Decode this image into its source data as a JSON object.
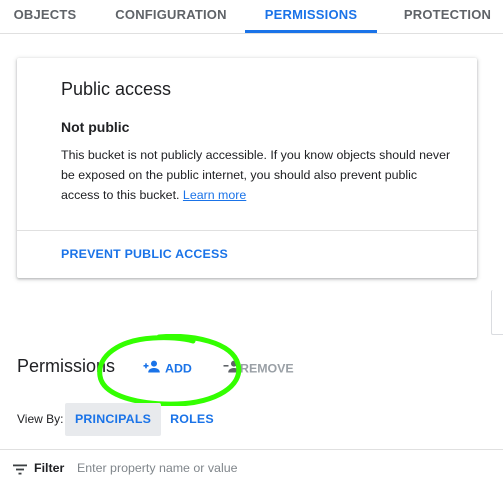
{
  "tabs": [
    {
      "label": "OBJECTS"
    },
    {
      "label": "CONFIGURATION"
    },
    {
      "label": "PERMISSIONS",
      "active": true
    },
    {
      "label": "PROTECTION"
    }
  ],
  "public_access": {
    "title": "Public access",
    "subtitle": "Not public",
    "body_text": "This bucket is not publicly accessible. If you know objects should never be exposed on the public internet, you should also prevent public access to this bucket.",
    "learn_more": "Learn more",
    "action_label": "PREVENT PUBLIC ACCESS"
  },
  "permissions": {
    "title": "Permissions",
    "add_label": "ADD",
    "remove_label": "REMOVE",
    "add_icon": "person-add-icon",
    "remove_icon": "person-remove-icon",
    "highlight_color": "#33ff00"
  },
  "view_by": {
    "label": "View By:",
    "options": [
      {
        "label": "PRINCIPALS",
        "selected": true
      },
      {
        "label": "ROLES",
        "selected": false
      }
    ]
  },
  "filter": {
    "icon": "filter-icon",
    "label": "Filter",
    "placeholder": "Enter property name or value"
  },
  "colors": {
    "accent": "#1a73e8",
    "text": "#202124",
    "muted": "#5f6368",
    "disabled": "#9aa0a6",
    "selected_bg": "#e8eaed"
  }
}
